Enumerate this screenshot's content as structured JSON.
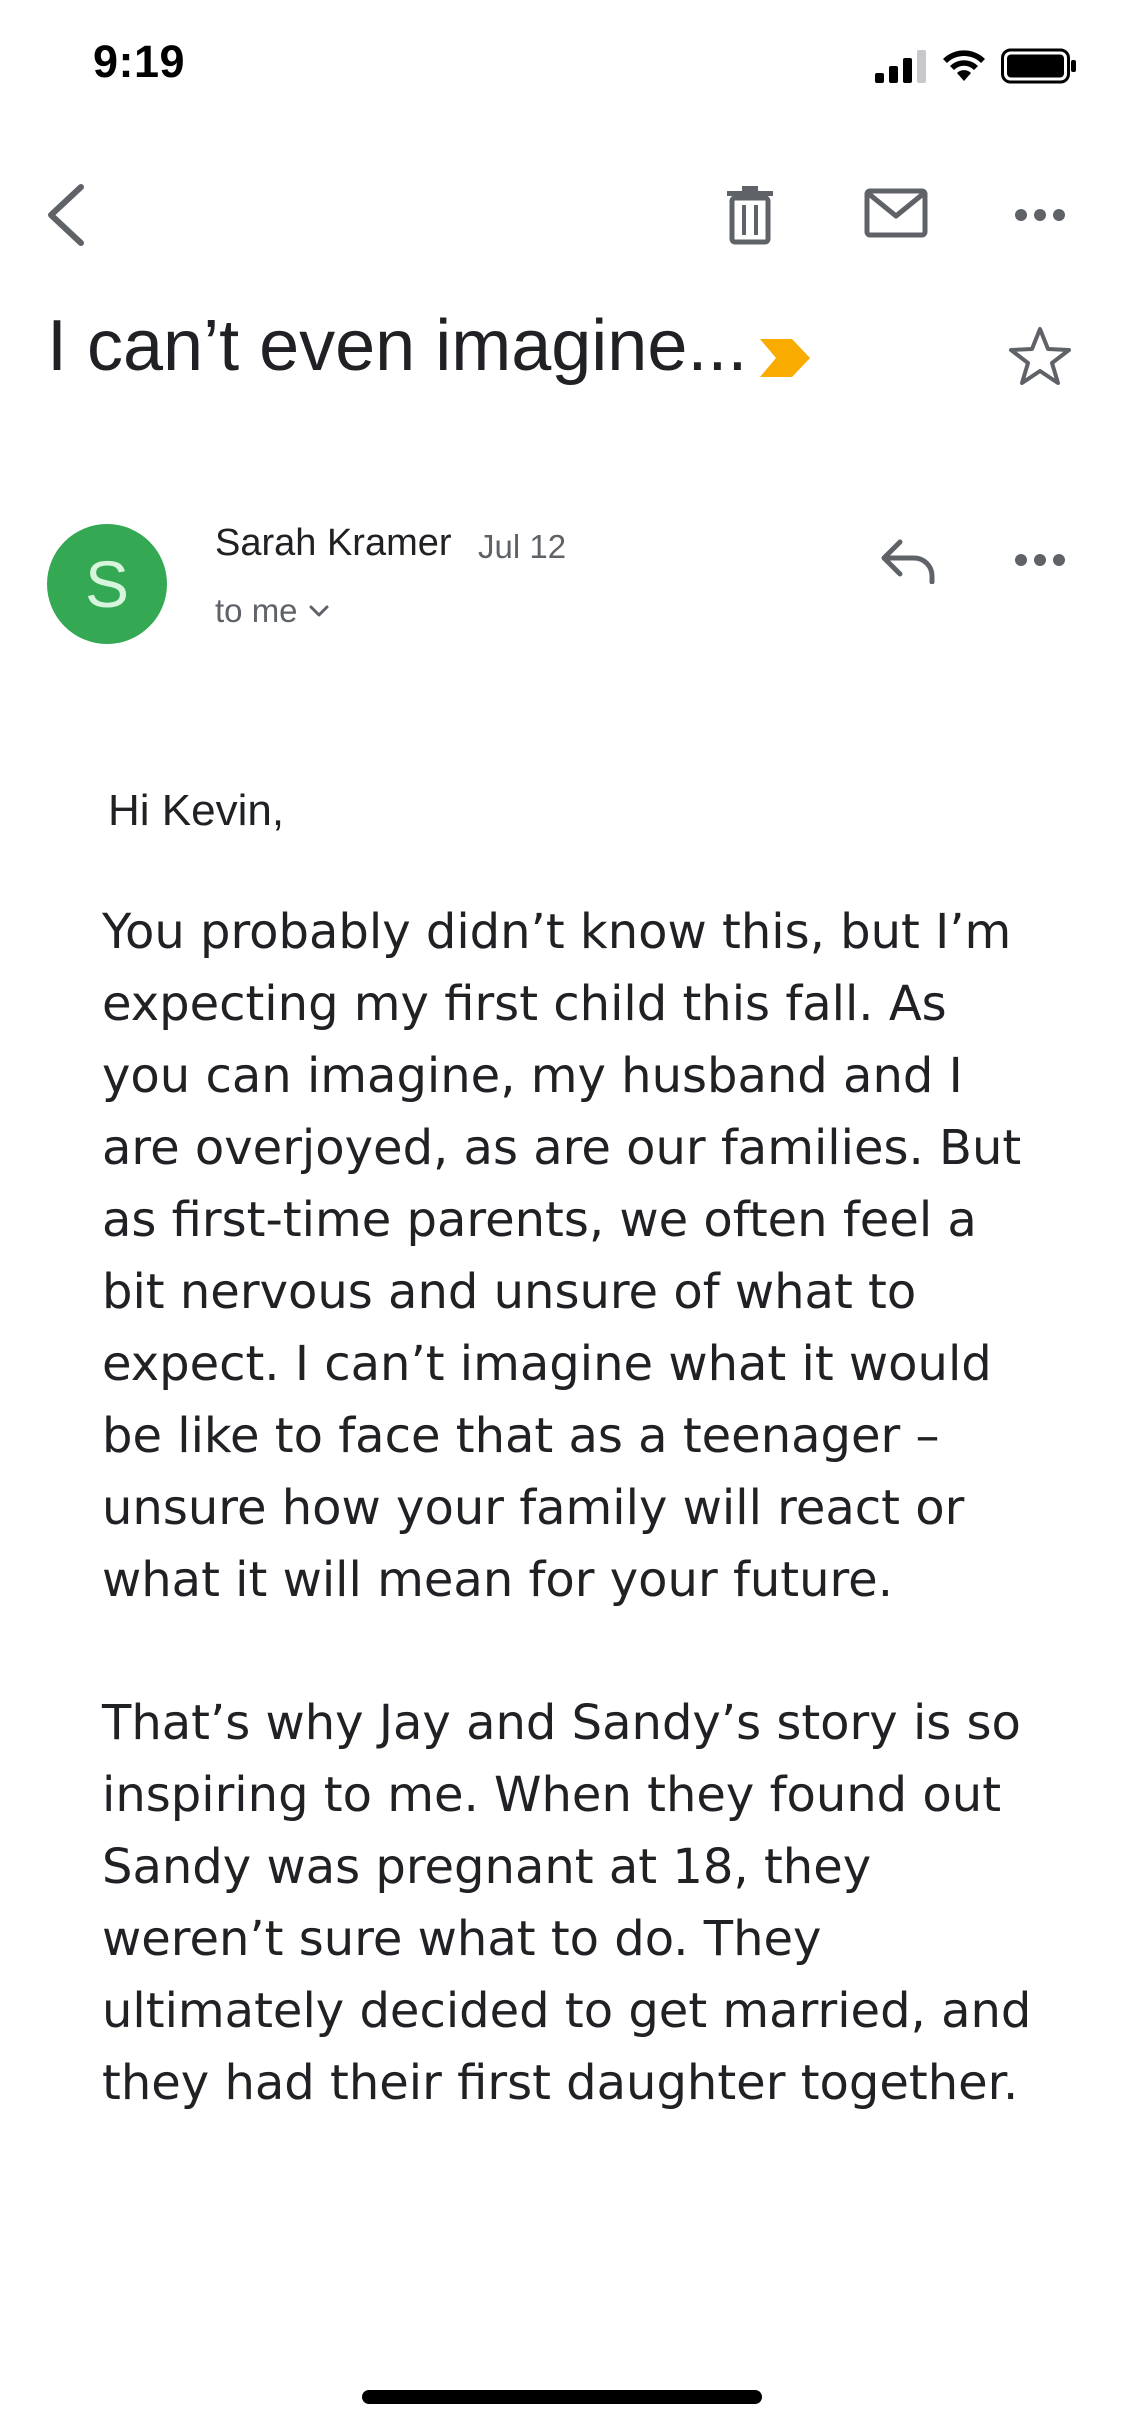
{
  "status_bar": {
    "time": "9:19",
    "icons": [
      "signal-icon",
      "wifi-icon",
      "battery-icon"
    ]
  },
  "toolbar": {
    "icons": [
      "back-icon",
      "trash-icon",
      "mail-icon",
      "more-horizontal-icon"
    ]
  },
  "email": {
    "subject": "I can’t even imagine...",
    "label_color": "#f9ab00",
    "starred": false,
    "sender": {
      "initial": "S",
      "avatar_color": "#34a853",
      "name": "Sarah Kramer",
      "date": "Jul 12",
      "recipients": "to me"
    },
    "greeting": "Hi Kevin,",
    "paragraphs": [
      "You probably didn’t know this, but I’m expecting my first child this fall. As you can imagine, my husband and I are overjoyed, as are our families. But as first-time parents, we often feel a bit nervous and unsure of what to expect. I can’t imagine what it would be like to face that as a teenager – unsure how your family will react or what it will mean for your future.",
      "That’s why Jay and Sandy’s story is so inspiring to me. When they found out Sandy was pregnant at 18, they weren’t sure what to do. They ultimately decided to get married, and they had their first daughter together."
    ]
  }
}
